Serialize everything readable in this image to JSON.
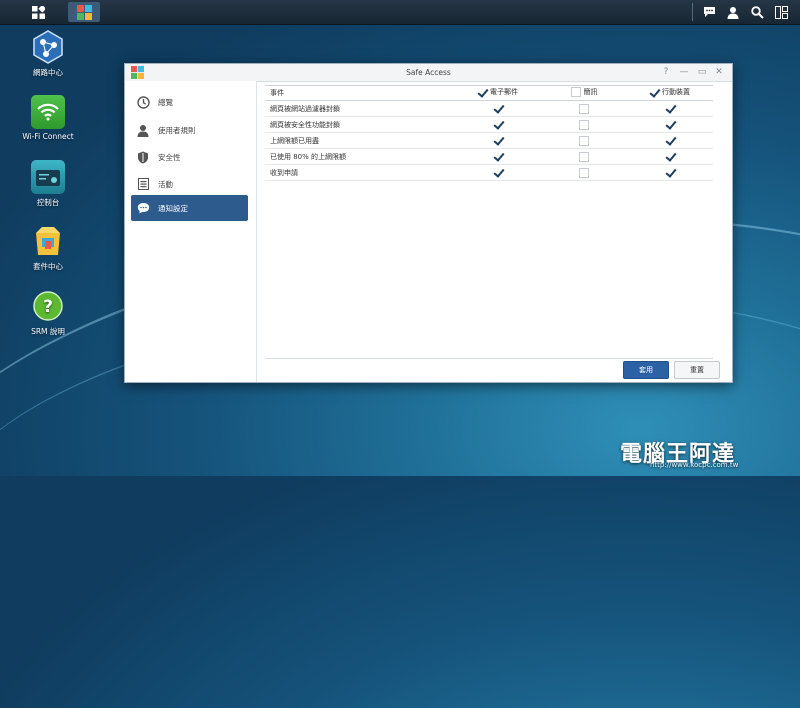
{
  "taskbar": {
    "main_menu_icon": "grid-menu-icon",
    "active_app_icon": "safe-access-icon",
    "right_icons": [
      "chat-icon",
      "user-icon",
      "search-icon",
      "widgets-icon"
    ]
  },
  "desktop": {
    "items": [
      {
        "label": "網路中心",
        "icon": "network-center-icon"
      },
      {
        "label": "Wi-Fi Connect",
        "icon": "wifi-icon"
      },
      {
        "label": "控制台",
        "icon": "control-panel-icon"
      },
      {
        "label": "套件中心",
        "icon": "package-center-icon"
      },
      {
        "label": "SRM 說明",
        "icon": "help-icon"
      }
    ]
  },
  "window": {
    "title": "Safe Access",
    "controls": [
      "?",
      "—",
      "▭",
      "✕"
    ],
    "sidebar": [
      {
        "label": "總覽",
        "icon": "clock-icon",
        "active": false
      },
      {
        "label": "使用者規則",
        "icon": "user-icon",
        "active": false
      },
      {
        "label": "安全性",
        "icon": "shield-icon",
        "active": false
      },
      {
        "label": "活動",
        "icon": "list-icon",
        "active": false
      },
      {
        "label": "通知設定",
        "icon": "chat-bubble-icon",
        "active": true
      }
    ],
    "table": {
      "columns": {
        "event": "事件",
        "email": "電子郵件",
        "sms": "簡訊",
        "mobile": "行動裝置"
      },
      "header_checked": {
        "email": true,
        "sms": false,
        "mobile": true
      },
      "rows": [
        {
          "event": "網頁被網站過濾器封鎖",
          "email": true,
          "sms": false,
          "mobile": true
        },
        {
          "event": "網頁被安全性功能封鎖",
          "email": true,
          "sms": false,
          "mobile": true
        },
        {
          "event": "上網限額已用盡",
          "email": true,
          "sms": false,
          "mobile": true
        },
        {
          "event": "已使用 80% 的上網限額",
          "email": true,
          "sms": false,
          "mobile": true
        },
        {
          "event": "收到申請",
          "email": true,
          "sms": false,
          "mobile": true
        }
      ]
    },
    "buttons": {
      "apply": "套用",
      "reset": "重置"
    }
  },
  "watermark": {
    "text": "電腦王阿達",
    "url": "http://www.kocpc.com.tw"
  }
}
